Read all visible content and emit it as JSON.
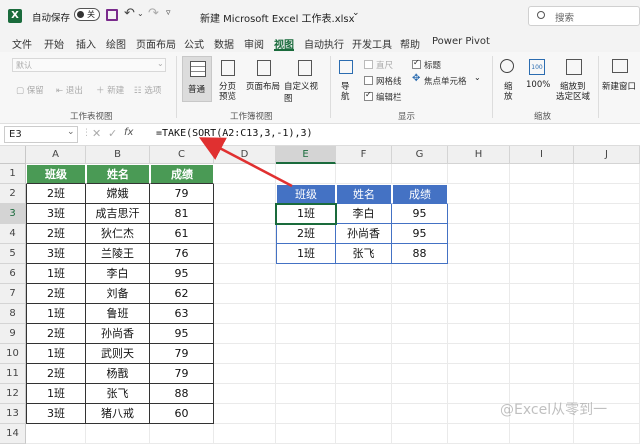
{
  "titlebar": {
    "autosave_label": "自动保存",
    "autosave_state": "关",
    "filename": "新建 Microsoft Excel 工作表.xlsx",
    "search_placeholder": "搜索"
  },
  "menu": [
    "文件",
    "开始",
    "插入",
    "绘图",
    "页面布局",
    "公式",
    "数据",
    "审阅",
    "视图",
    "自动执行",
    "开发工具",
    "帮助",
    "Power Pivot"
  ],
  "active_menu": "视图",
  "ribbon": {
    "sheetview": {
      "default_value": "默认",
      "keep": "保留",
      "exit": "退出",
      "new": "新建",
      "options": "选项",
      "group": "工作表视图"
    },
    "workbook_views": {
      "normal": "普通",
      "pagebreak_1": "分页",
      "pagebreak_2": "预览",
      "pagelayout": "页面布局",
      "custom": "自定义视图",
      "group": "工作簿视图"
    },
    "show": {
      "nav": "导",
      "nav2": "航",
      "ruler": "直尺",
      "gridlines": "网格线",
      "formulabar": "编辑栏",
      "headings": "标题",
      "focuscell": "焦点单元格",
      "group": "显示"
    },
    "zoom": {
      "zoom_1": "缩",
      "zoom_2": "放",
      "hundred": "100%",
      "selection_1": "缩放到",
      "selection_2": "选定区域",
      "group": "缩放"
    },
    "window": {
      "newwindow": "新建窗口"
    }
  },
  "formula_bar": {
    "namebox": "E3",
    "fx": "fx",
    "formula": "=TAKE(SORT(A2:C13,3,-1),3)"
  },
  "columns": [
    "A",
    "B",
    "C",
    "D",
    "E",
    "F",
    "G",
    "H",
    "I",
    "J"
  ],
  "rows": [
    "1",
    "2",
    "3",
    "4",
    "5",
    "6",
    "7",
    "8",
    "9",
    "10",
    "11",
    "12",
    "13",
    "14"
  ],
  "source_table": {
    "headers": [
      "班级",
      "姓名",
      "成绩"
    ],
    "rows": [
      [
        "2班",
        "嫦娥",
        "79"
      ],
      [
        "3班",
        "成吉思汗",
        "81"
      ],
      [
        "2班",
        "狄仁杰",
        "61"
      ],
      [
        "3班",
        "兰陵王",
        "76"
      ],
      [
        "1班",
        "李白",
        "95"
      ],
      [
        "2班",
        "刘备",
        "62"
      ],
      [
        "1班",
        "鲁班",
        "63"
      ],
      [
        "2班",
        "孙尚香",
        "95"
      ],
      [
        "1班",
        "武则天",
        "79"
      ],
      [
        "2班",
        "杨戬",
        "79"
      ],
      [
        "1班",
        "张飞",
        "88"
      ],
      [
        "3班",
        "猪八戒",
        "60"
      ]
    ]
  },
  "result_table": {
    "headers": [
      "班级",
      "姓名",
      "成绩"
    ],
    "rows": [
      [
        "1班",
        "李白",
        "95"
      ],
      [
        "2班",
        "孙尚香",
        "95"
      ],
      [
        "1班",
        "张飞",
        "88"
      ]
    ]
  },
  "watermark": "@Excel从零到一",
  "colors": {
    "source_header": "#4a9a55",
    "result_header": "#4472c4",
    "arrow": "#e03030",
    "excel_green": "#1a6b3c"
  }
}
